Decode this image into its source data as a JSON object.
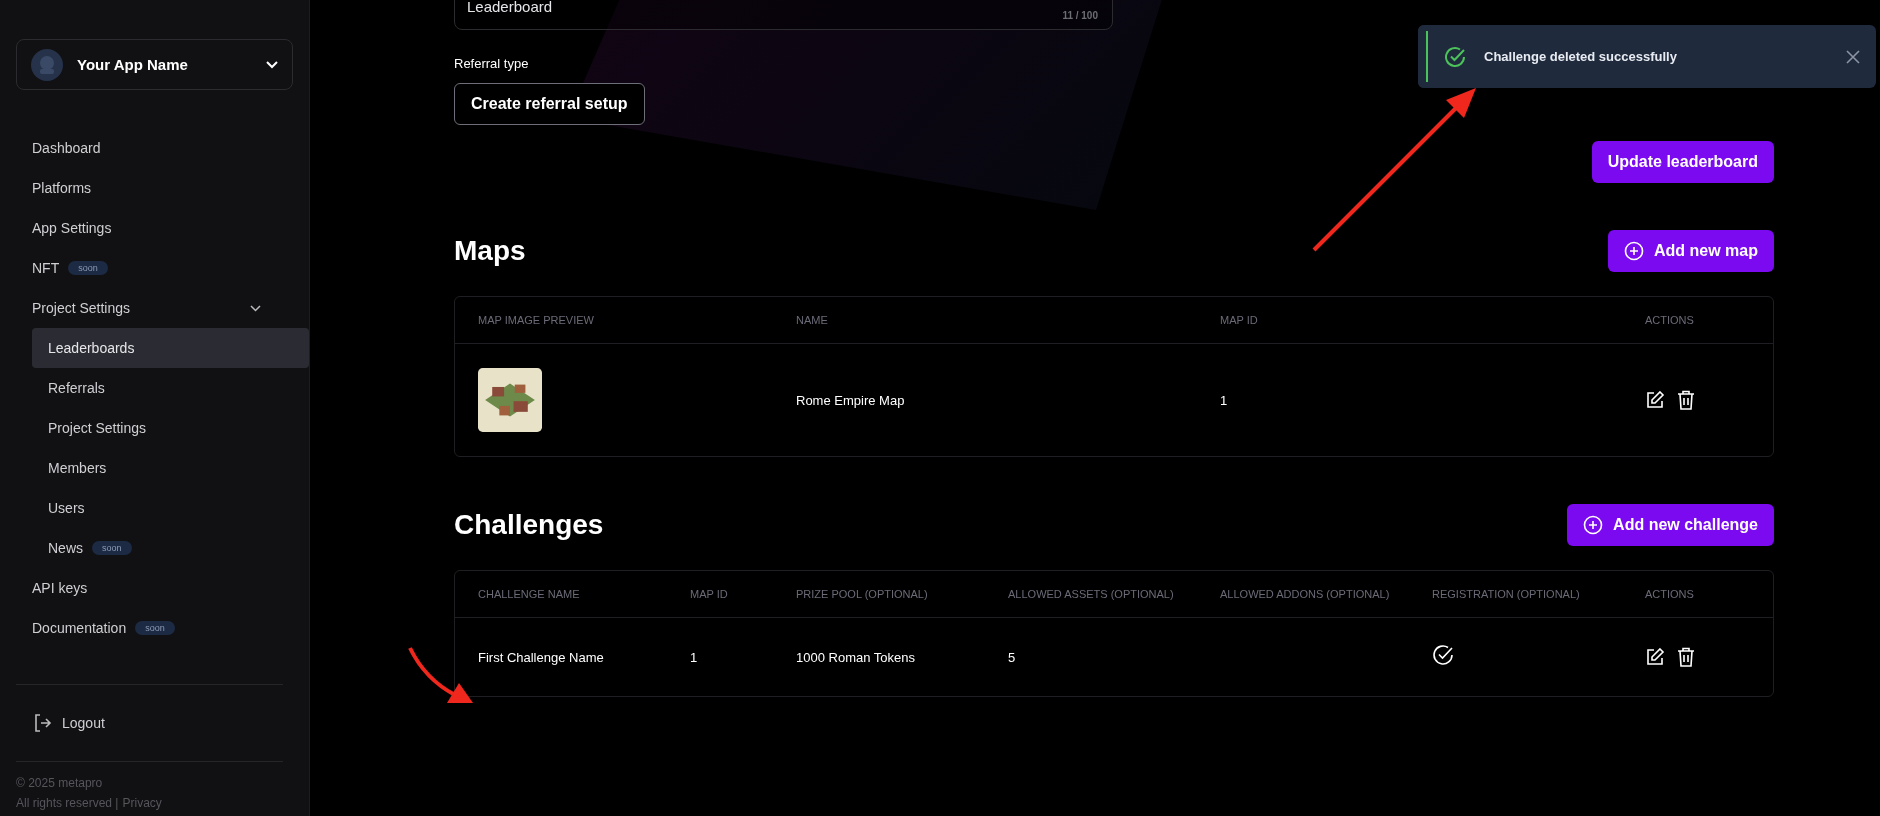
{
  "sidebar": {
    "app_name": "Your App Name",
    "nav": [
      {
        "label": "Dashboard",
        "selected": false
      },
      {
        "label": "Platforms",
        "selected": false
      },
      {
        "label": "App Settings",
        "selected": false
      },
      {
        "label": "NFT",
        "selected": false,
        "badge": "soon"
      },
      {
        "label": "Project Settings",
        "selected": false,
        "expanded": true,
        "children": [
          {
            "label": "Leaderboards",
            "selected": true
          },
          {
            "label": "Referrals",
            "selected": false
          },
          {
            "label": "Project Settings",
            "selected": false
          },
          {
            "label": "Members",
            "selected": false
          },
          {
            "label": "Users",
            "selected": false
          },
          {
            "label": "News",
            "selected": false,
            "badge": "soon"
          }
        ]
      },
      {
        "label": "API keys",
        "selected": false
      },
      {
        "label": "Documentation",
        "selected": false,
        "badge": "soon"
      }
    ],
    "logout": "Logout",
    "footer": {
      "copyright": "© 2025 metapro",
      "rights": "All rights reserved |",
      "privacy": "Privacy"
    }
  },
  "form": {
    "name_field": {
      "value": "Leaderboard",
      "counter": "11 / 100"
    },
    "referral_label": "Referral type",
    "referral_button": "Create referral setup",
    "update_button": "Update leaderboard"
  },
  "maps": {
    "title": "Maps",
    "add_button": "Add new map",
    "columns": [
      "MAP IMAGE PREVIEW",
      "NAME",
      "MAP ID",
      "ACTIONS"
    ],
    "rows": [
      {
        "name": "Rome Empire Map",
        "map_id": "1"
      }
    ]
  },
  "challenges": {
    "title": "Challenges",
    "add_button": "Add new challenge",
    "columns": [
      "CHALLENGE NAME",
      "MAP ID",
      "PRIZE POOL (OPTIONAL)",
      "ALLOWED ASSETS (OPTIONAL)",
      "ALLOWED ADDONS (OPTIONAL)",
      "REGISTRATION (OPTIONAL)",
      "ACTIONS"
    ],
    "rows": [
      {
        "name": "First Challenge Name",
        "map_id": "1",
        "prize_pool": "1000 Roman Tokens",
        "allowed_assets": "5",
        "registration": true
      }
    ]
  },
  "toast": {
    "message": "Challenge deleted successfully"
  }
}
